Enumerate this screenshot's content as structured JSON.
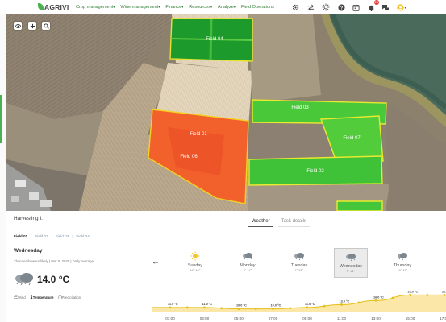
{
  "nav": {
    "logo": "AGRIVI",
    "menus": [
      {
        "label": "Crop management",
        "caret": "▾"
      },
      {
        "label": "Wine management",
        "caret": "▾"
      },
      {
        "label": "Finance",
        "caret": "▾"
      },
      {
        "label": "Resources",
        "caret": "▾"
      },
      {
        "label": "Analyze",
        "caret": "▾"
      },
      {
        "label": "Field Operations",
        "caret": ""
      }
    ],
    "icons": [
      "gear-icon",
      "transfer-icon",
      "weather-sun-icon",
      "help-icon",
      "calendar-icon",
      "notifications-icon",
      "chat-icon",
      "user-icon"
    ],
    "notification_count": "24",
    "user_caret": "▾"
  },
  "map": {
    "controls": [
      "layers-icon",
      "add-icon",
      "search-icon"
    ],
    "fields": [
      {
        "name": "Field 04",
        "color": "#1d9a2c"
      },
      {
        "name": "Field 01",
        "color": "#f2602c"
      },
      {
        "name": "Field 06",
        "color": "#ea4a25"
      },
      {
        "name": "Field 03",
        "color": "#49c93a"
      },
      {
        "name": "Field 07",
        "color": "#53cc3c"
      },
      {
        "name": "Field 02",
        "color": "#3fc238"
      },
      {
        "name": "Field 08",
        "color": "#45c539"
      }
    ]
  },
  "panel": {
    "task_title": "Harvesting I.",
    "detail_tabs": [
      "Weather",
      "Task details"
    ],
    "active_detail_tab": "Weather",
    "field_tabs": [
      "Field 01",
      "Field 02",
      "Field 03",
      "Field 04"
    ],
    "active_field_tab": "Field 01",
    "field_sep": "|"
  },
  "weather": {
    "day": "Wednesday",
    "meta": "Thundershowers likely  |  Mar 5, 2025  |  Daily average",
    "temperature": "14.0 °C",
    "metrics": [
      {
        "label": "Wind",
        "icon": "wind-icon"
      },
      {
        "label": "Temperature",
        "icon": "thermometer-icon"
      },
      {
        "label": "Precipitation",
        "icon": "precipitation-icon"
      }
    ],
    "active_metric": "Temperature",
    "back_arrow": "←",
    "days": [
      {
        "name": "Sunday",
        "range": "10° 14°",
        "icon": "sun-icon"
      },
      {
        "name": "Monday",
        "range": "9° 17°",
        "icon": "cloud-rain-icon"
      },
      {
        "name": "Tuesday",
        "range": "7° 20°",
        "icon": "cloud-rain-icon"
      },
      {
        "name": "Wednesday",
        "range": "9° 21°",
        "icon": "cloud-rain-icon"
      },
      {
        "name": "Thursday",
        "range": "10° 19°",
        "icon": "cloud-rain-icon"
      }
    ],
    "selected_day": "Wednesday"
  },
  "chart_data": {
    "type": "area",
    "x": [
      "01:00",
      "03:00",
      "05:00",
      "07:00",
      "09:00",
      "11:00",
      "13:00",
      "15:00",
      "17:00"
    ],
    "series": [
      {
        "values": [
          11.0,
          11.0,
          10.0,
          10.0,
          11.0,
          13.0,
          16.0,
          20.0,
          20.0
        ]
      }
    ],
    "point_labels": [
      "11.0 °C",
      "11.0 °C",
      "10.0 °C",
      "10.0 °C",
      "11.0 °C",
      "13.0 °C",
      "16.0 °C",
      "20.0 °C",
      "20.0 °C"
    ],
    "ylim": [
      8,
      22
    ],
    "fill_color": "#fbe7a8",
    "line_color": "#e5bf18",
    "grid": false
  }
}
